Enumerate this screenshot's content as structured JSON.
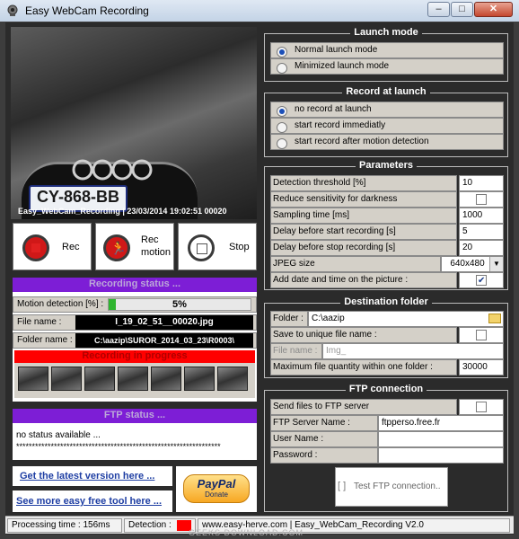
{
  "window": {
    "title": "Easy WebCam Recording",
    "controls": {
      "minimize": "–",
      "maximize": "□",
      "close": "✕"
    }
  },
  "camera": {
    "overlay_text": "Easy_WebCam_Recording | 23/03/2014  19:02:51  00020",
    "plate_text": "CY-868-BB"
  },
  "buttons": {
    "rec": "Rec",
    "rec_motion_line1": "Rec",
    "rec_motion_line2": "motion",
    "stop": "Stop"
  },
  "recording_status": {
    "header": "Recording status ...",
    "motion_label": "Motion detection [%] :",
    "motion_value": "5%",
    "motion_fraction": 0.05,
    "file_label": "File name :",
    "file_value": "I_19_02_51__00020.jpg",
    "folder_label": "Folder name :",
    "folder_value": "C:\\aazip\\SUROR_2014_03_23\\R0003\\",
    "progress_header": "Recording in progress"
  },
  "ftp_status": {
    "header": "FTP status ...",
    "line1": "no status available ...",
    "line2": "*****************************************************************"
  },
  "links": {
    "latest": "Get the latest version here ...",
    "more": "See more easy free tool here ..."
  },
  "paypal": {
    "brand": "PayPal",
    "sub": "Donate"
  },
  "launch_mode": {
    "title": "Launch mode",
    "options": [
      {
        "label": "Normal launch mode",
        "selected": true
      },
      {
        "label": "Minimized launch mode",
        "selected": false
      }
    ]
  },
  "record_at_launch": {
    "title": "Record at launch",
    "options": [
      {
        "label": "no record at launch",
        "selected": true
      },
      {
        "label": "start record immediatly",
        "selected": false
      },
      {
        "label": "start record after motion detection",
        "selected": false
      }
    ]
  },
  "parameters": {
    "title": "Parameters",
    "detection_threshold": {
      "label": "Detection threshold [%]",
      "value": "10"
    },
    "reduce_sensitivity": {
      "label": "Reduce sensitivity for darkness",
      "checked": false
    },
    "sampling_time": {
      "label": "Sampling time [ms]",
      "value": "1000"
    },
    "delay_start": {
      "label": "Delay before start recording [s]",
      "value": "5"
    },
    "delay_stop": {
      "label": "Delay before stop recording [s]",
      "value": "20"
    },
    "jpeg_size": {
      "label": "JPEG size",
      "value": "640x480"
    },
    "add_datetime": {
      "label": "Add date and time on the picture :",
      "checked": true
    }
  },
  "destination": {
    "title": "Destination folder",
    "folder_label": "Folder :",
    "folder_value": "C:\\aazip",
    "unique_label": "Save to unique file name :",
    "unique_checked": false,
    "filename_label": "File name :",
    "filename_value": "Img_",
    "maxq_label": "Maximum file quantity within one folder :",
    "maxq_value": "30000"
  },
  "ftp_connection": {
    "title": "FTP connection",
    "send_label": "Send files to FTP server",
    "send_checked": false,
    "server_label": "FTP Server Name :",
    "server_value": "ftpperso.free.fr",
    "user_label": "User Name :",
    "user_value": "",
    "password_label": "Password :",
    "password_value": "",
    "test_button": "Test FTP connection..",
    "test_prefix": "[ ]"
  },
  "status_bar": {
    "processing": "Processing time : 156ms",
    "detection_label": "Detection :",
    "detection_color": "#ff0000",
    "footer": "www.easy-herve.com  |  Easy_WebCam_Recording V2.0",
    "watermark": "GEEKS DOWNLOAD.COM"
  }
}
